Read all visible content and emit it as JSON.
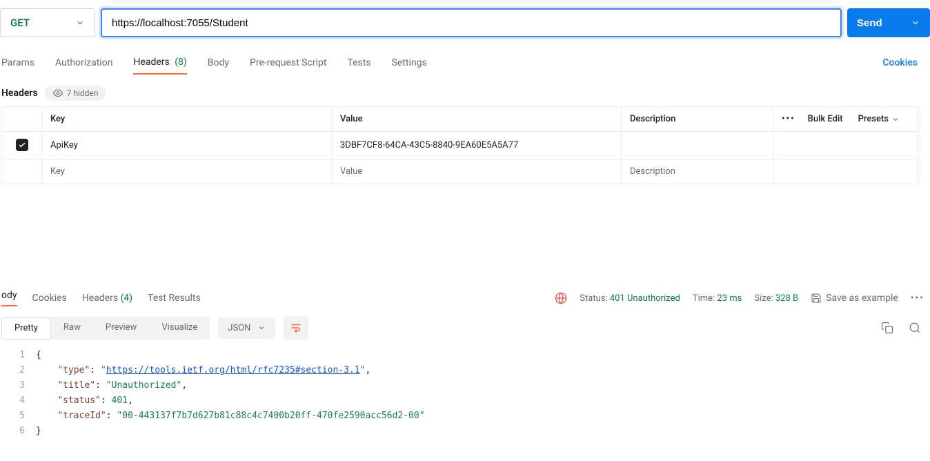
{
  "request": {
    "method": "GET",
    "url": "https://localhost:7055/Student",
    "send_label": "Send"
  },
  "tabs": {
    "params": "Params",
    "authorization": "Authorization",
    "headers": "Headers",
    "headers_count": "(8)",
    "body": "Body",
    "prerequest": "Pre-request Script",
    "tests": "Tests",
    "settings": "Settings",
    "cookies": "Cookies"
  },
  "headers_section": {
    "title": "Headers",
    "hidden_label": "7 hidden",
    "columns": {
      "key": "Key",
      "value": "Value",
      "description": "Description",
      "bulk_edit": "Bulk Edit",
      "presets": "Presets"
    },
    "rows": [
      {
        "checked": true,
        "key": "ApiKey",
        "value": "3DBF7CF8-64CA-43C5-8840-9EA60E5A5A77",
        "description": ""
      }
    ],
    "placeholder": {
      "key": "Key",
      "value": "Value",
      "description": "Description"
    }
  },
  "response": {
    "tabs": {
      "body": "ody",
      "cookies": "Cookies",
      "headers": "Headers",
      "headers_count": "(4)",
      "test_results": "Test Results"
    },
    "status_label": "Status:",
    "status_value": "401 Unauthorized",
    "time_label": "Time:",
    "time_value": "23 ms",
    "size_label": "Size:",
    "size_value": "328 B",
    "save_example": "Save as example",
    "view": {
      "pretty": "Pretty",
      "raw": "Raw",
      "preview": "Preview",
      "visualize": "Visualize",
      "format": "JSON"
    },
    "json": {
      "type_key": "\"type\"",
      "type_val": "\"https://tools.ietf.org/html/rfc7235#section-3.1\"",
      "type_link": "https://tools.ietf.org/html/rfc7235#section-3.1",
      "title_key": "\"title\"",
      "title_val": "\"Unauthorized\"",
      "status_key": "\"status\"",
      "status_val": "401",
      "traceId_key": "\"traceId\"",
      "traceId_val": "\"00-443137f7b7d627b81c88c4c7400b20ff-470fe2590acc56d2-00\""
    }
  }
}
